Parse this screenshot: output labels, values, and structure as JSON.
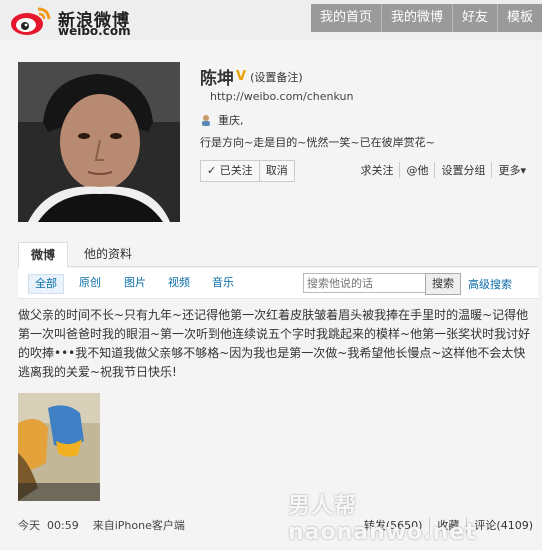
{
  "header": {
    "brand": "新浪微博",
    "domain": "weibo.com",
    "nav": [
      "我的首页",
      "我的微博",
      "好友",
      "模板"
    ]
  },
  "profile": {
    "name": "陈坤",
    "verified_badge": "V",
    "remark_link": "(设置备注)",
    "url": "http://weibo.com/chenkun",
    "location": "重庆,",
    "motto": "行是方向~走是目的~恍然一笑~已在彼岸赏花~",
    "follow_status": "✓ 已关注",
    "unfollow": "取消",
    "actions": [
      "求关注",
      "@他",
      "设置分组",
      "更多▾"
    ]
  },
  "tabs": {
    "weibo": "微博",
    "info": "他的资料"
  },
  "filters": {
    "items": [
      "全部",
      "原创",
      "图片",
      "视频",
      "音乐"
    ],
    "search_placeholder": "搜索他说的话",
    "search_button": "搜索",
    "advanced": "高级搜索"
  },
  "post": {
    "text": "做父亲的时间不长~只有九年~还记得他第一次红着皮肤皱着眉头被我捧在手里时的温暖~记得他第一次叫爸爸时我的眼泪~第一次听到他连续说五个字时我跳起来的模样~他第一张奖状时我讨好的吹捧•••我不知道我做父亲够不够格~因为我也是第一次做~我希望他长慢点~这样他不会太快逃离我的关爱~祝我节日快乐!",
    "time_day": "今天",
    "time": "00:59",
    "source": "来自iPhone客户端",
    "repost": "转发(5650)",
    "favorite": "收藏",
    "comment": "评论(4109)"
  },
  "watermark": "男人帮naonanwo.net",
  "colors": {
    "link": "#0a8cd2",
    "nav_bg": "#9a9a9a",
    "badge": "#e8a000"
  }
}
